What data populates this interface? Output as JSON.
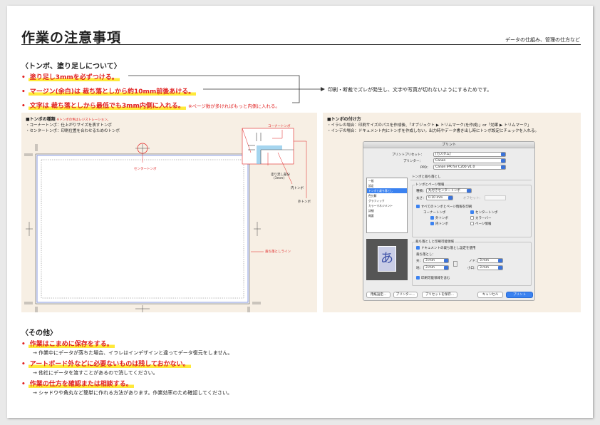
{
  "header": {
    "title": "作業の注意事項",
    "subtitle": "データの仕組み、管理の仕方など"
  },
  "section1": {
    "heading": "〈トンボ、塗り足しについて〉",
    "bullets": [
      "塗り足し3mmを必ずつける。",
      "マージン(余白)は 裁ち落としから約10mm前後あける。",
      "文字は 裁ち落としから最低でも3mm内側に入れる。"
    ],
    "bullet_note": "※ページ数が多ければもっと内側に入れる。",
    "arrow_note": "印刷・断裁でズレが発生し、文字や写真が切れないようにするためです。"
  },
  "left_panel": {
    "heading": "■トンボの種類",
    "heading_note": "※トンボの色はレジストレーション。",
    "lines": [
      "・コーナートンボ：仕上がりサイズを表すトンボ",
      "・センタートンボ：印刷位置を合わせるためのトンボ"
    ],
    "labels": {
      "corner": "コーナートンボ",
      "center": "センタートンボ",
      "bleed": "塗り足し部分",
      "bleed_size": "(3mm)",
      "inner": "内トンボ",
      "outer": "外トンボ",
      "trim_line": "裁ち落としライン"
    }
  },
  "right_panel": {
    "heading": "■トンボの付け方",
    "lines": [
      "・イラレの場合：印刷サイズのパスを作成後、「オブジェクト ▶ トリムマーク(を作成)」or「効果 ▶ トリムマーク」",
      "・インデの場合：ドキュメント内にトンボを作成しない。出力時やデータ書き出し時にトンボ設定にチェックを入れる。"
    ],
    "dialog": {
      "title": "プリント",
      "preset_label": "プリントプリセット：",
      "preset_value": "[カスタム]",
      "printer_label": "プリンター：",
      "printer_value": "Canon",
      "ppd_label": "PPD：",
      "ppd_value": "Canon iPR for C200 V1.0",
      "section_title": "トンボと裁ち落とし",
      "list_items": [
        "一般",
        "設定",
        "トンボと裁ち落とし",
        "色分解",
        "グラフィック",
        "カラーマネジメント",
        "詳細",
        "概要"
      ],
      "marks_group": "トンボとページ情報",
      "type_label": "種類：",
      "type_value": "丸付きセンタートンボ",
      "thickness_label": "太さ：",
      "thickness_value": "0.10 mm",
      "offset_label": "オフセット：",
      "all_marks": "すべてのトンボとページ情報を印刷",
      "corner_marks": "コーナートンボ",
      "outer_marks": "外トンボ",
      "inner_marks": "内トンボ",
      "center_marks": "センタートンボ",
      "color_bar": "カラーバー",
      "page_info": "ページ情報",
      "bleed_group": "裁ち落としと印刷可能領域",
      "use_doc_bleed": "ドキュメントの裁ち落とし設定を使用",
      "bleed_label": "裁ち落とし：",
      "top_label": "天：",
      "bottom_label": "地：",
      "inside_label": "ノド：",
      "outside_label": "小口：",
      "bleed_value": "3 mm",
      "include_slug": "印刷可能領域を含む",
      "preview_char": "あ",
      "buttons": {
        "setup": "用紙設定...",
        "printer": "プリンター...",
        "save_preset": "プリセットを保存...",
        "cancel": "キャンセル",
        "print": "プリント"
      }
    }
  },
  "section2": {
    "heading": "〈その他〉",
    "items": [
      {
        "bullet": "作業はこまめに保存をする。",
        "detail": "→ 作業中にデータが落ちた場合、イラレはインデザインと違ってデータ復元をしません。"
      },
      {
        "bullet": "アートボード外などに必要ないものは残しておかない。",
        "detail": "→ 他社にデータを渡すことがあるので消してください。"
      },
      {
        "bullet": "作業の仕方を確認または相談する。",
        "detail": "→ シャドウや角丸など簡単に作れる方法があります。作業効率のため確認してください。"
      }
    ]
  },
  "colors": {
    "accent_red": "#e02020",
    "highlight": "#ffe93a",
    "panel_bg": "#f7efe4",
    "mac_blue": "#3b82f0"
  }
}
